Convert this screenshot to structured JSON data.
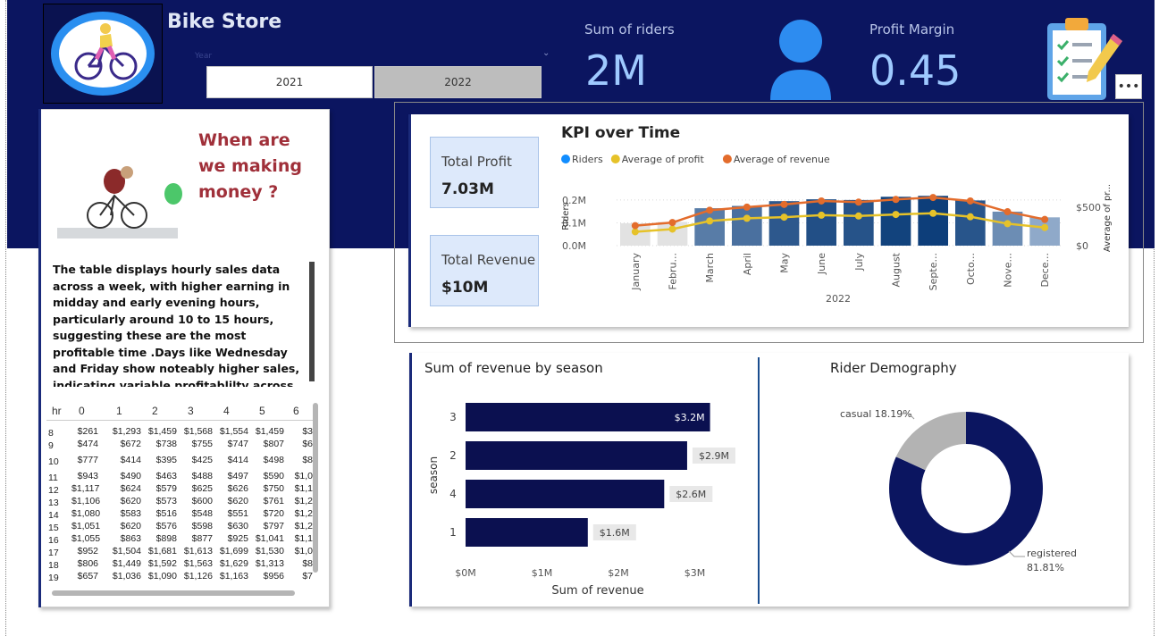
{
  "header": {
    "title": "Bike Store",
    "year_label": "Year",
    "years": [
      "2021",
      "2022"
    ],
    "selected_year": "2022",
    "kpis": [
      {
        "label": "Sum of riders",
        "value": "2M"
      },
      {
        "label": "Profit Margin",
        "value": "0.45"
      }
    ],
    "more_label": "•••"
  },
  "left_panel": {
    "question": [
      "When are",
      "we making",
      "money ?"
    ],
    "description": "The table displays hourly sales data across a week, with higher earning  in midday and early evening hours, particularly around 10 to 15 hours, suggesting these are the most profitable time .Days like Wednesday and Friday show noteably higher sales, indicating variable profitablilty across the week.",
    "table": {
      "columns": [
        "hr",
        "0",
        "1",
        "2",
        "3",
        "4",
        "5",
        "6"
      ],
      "rows": [
        [
          "8",
          "$261",
          "$1,293",
          "$1,459",
          "$1,568",
          "$1,554",
          "$1,459",
          "$3"
        ],
        [
          "9",
          "$474",
          "$672",
          "$738",
          "$755",
          "$747",
          "$807",
          "$6"
        ],
        [
          "10",
          "$777",
          "$414",
          "$395",
          "$425",
          "$414",
          "$498",
          "$8"
        ],
        [
          "11",
          "$943",
          "$490",
          "$463",
          "$488",
          "$497",
          "$590",
          "$1,0"
        ],
        [
          "12",
          "$1,117",
          "$624",
          "$579",
          "$625",
          "$626",
          "$750",
          "$1,1"
        ],
        [
          "13",
          "$1,106",
          "$620",
          "$573",
          "$600",
          "$620",
          "$761",
          "$1,2"
        ],
        [
          "14",
          "$1,080",
          "$583",
          "$516",
          "$548",
          "$551",
          "$720",
          "$1,2"
        ],
        [
          "15",
          "$1,051",
          "$620",
          "$576",
          "$598",
          "$630",
          "$797",
          "$1,2"
        ],
        [
          "16",
          "$1,055",
          "$863",
          "$898",
          "$877",
          "$925",
          "$1,041",
          "$1,1"
        ],
        [
          "17",
          "$952",
          "$1,504",
          "$1,681",
          "$1,613",
          "$1,699",
          "$1,530",
          "$1,0"
        ],
        [
          "18",
          "$806",
          "$1,449",
          "$1,592",
          "$1,563",
          "$1,629",
          "$1,313",
          "$8"
        ],
        [
          "19",
          "$657",
          "$1,036",
          "$1,090",
          "$1,126",
          "$1,163",
          "$956",
          "$7"
        ]
      ]
    }
  },
  "kpi_card": {
    "total_profit_label": "Total Profit",
    "total_profit": "7.03M",
    "total_revenue_label": "Total Revenue",
    "total_revenue": "$10M"
  },
  "chart_data": [
    {
      "type": "bar",
      "title": "KPI over Time",
      "xlabel": "2022",
      "ylabel": "Riders",
      "y2label": "Average of pr...",
      "categories": [
        "January",
        "Febru...",
        "March",
        "April",
        "May",
        "June",
        "July",
        "August",
        "Septe...",
        "Octo...",
        "Nove...",
        "Dece..."
      ],
      "legend": [
        "Riders",
        "Average of profit",
        "Average of revenue"
      ],
      "legend_colors": [
        "#118dff",
        "#e6c229",
        "#e36c2c"
      ],
      "series": [
        {
          "name": "Riders",
          "values": [
            0.098,
            0.104,
            0.164,
            0.174,
            0.195,
            0.203,
            0.2,
            0.214,
            0.218,
            0.198,
            0.149,
            0.124
          ]
        },
        {
          "name": "Average of profit",
          "values": [
            180,
            215,
            320,
            355,
            370,
            395,
            385,
            405,
            420,
            375,
            285,
            235
          ]
        },
        {
          "name": "Average of revenue",
          "values": [
            260,
            300,
            460,
            500,
            535,
            580,
            565,
            600,
            625,
            580,
            440,
            340
          ]
        }
      ],
      "ylim": [
        0,
        0.27
      ],
      "y_ticks": [
        "0.0M",
        "0.1M",
        "0.2M"
      ],
      "y2lim": [
        0,
        800
      ],
      "y2_ticks": [
        "$0",
        "$500"
      ]
    },
    {
      "type": "bar",
      "title": "Sum of revenue by season",
      "orientation": "horizontal",
      "xlabel": "Sum of revenue",
      "ylabel": "season",
      "categories": [
        "3",
        "2",
        "4",
        "1"
      ],
      "values": [
        3.2,
        2.9,
        2.6,
        1.6
      ],
      "value_labels": [
        "$3.2M",
        "$2.9M",
        "$2.6M",
        "$1.6M"
      ],
      "x_ticks": [
        "$0M",
        "$1M",
        "$2M",
        "$3M"
      ],
      "xlim": [
        0,
        3.2
      ]
    },
    {
      "type": "pie",
      "title": "Rider Demography",
      "categories": [
        "casual",
        "registered"
      ],
      "values": [
        18.19,
        81.81
      ],
      "labels": [
        "casual 18.19%",
        "registered",
        "81.81%"
      ],
      "colors": [
        "#b3b3b3",
        "#0b1560"
      ]
    }
  ]
}
